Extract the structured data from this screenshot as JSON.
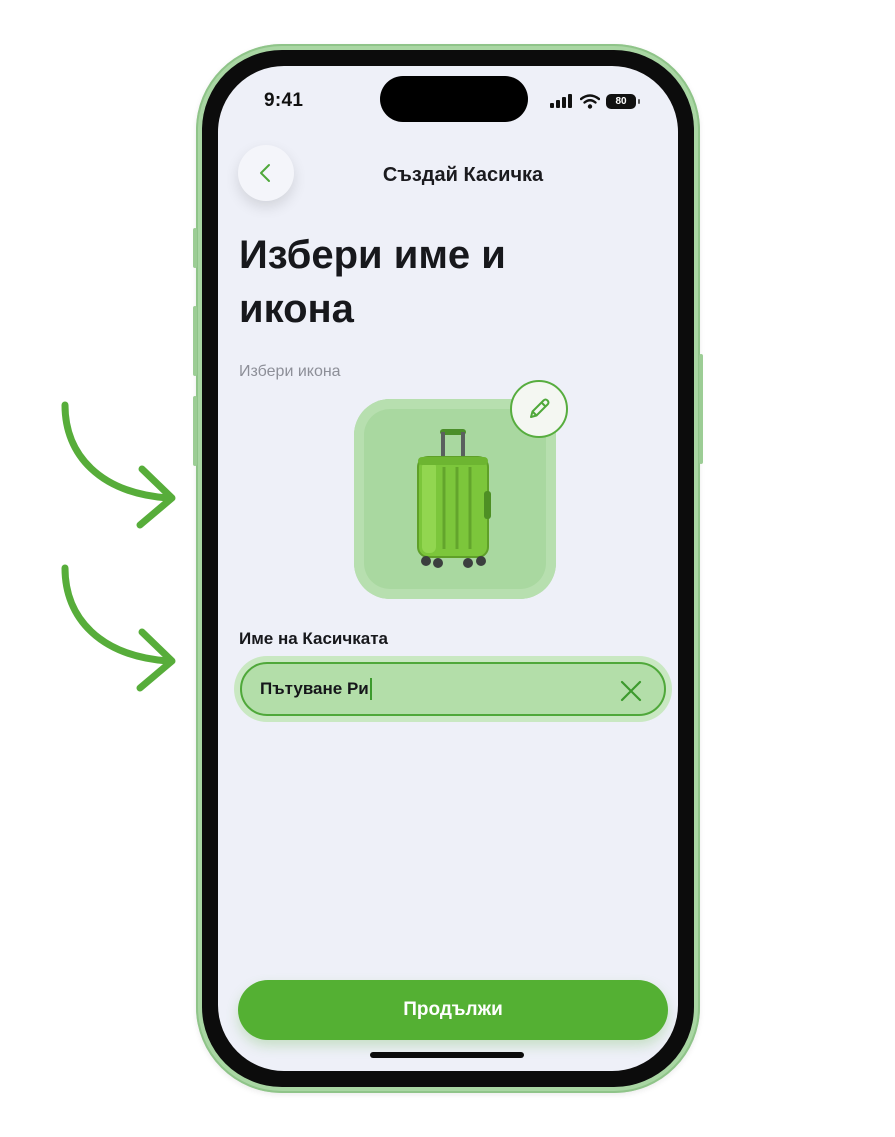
{
  "status_bar": {
    "time": "9:41",
    "battery": "80",
    "icons": [
      "signal-icon",
      "wifi-icon",
      "battery-icon"
    ]
  },
  "nav": {
    "back_icon": "chevron-left-icon",
    "title": "Създай Касичка"
  },
  "content": {
    "heading": "Избери име и икона",
    "subtitle": "Избери икона",
    "selected_icon": "suitcase-icon",
    "edit_icon": "pencil-icon",
    "field_label": "Име на Касичката",
    "field_value": "Пътуване Ри",
    "clear_icon": "close-icon"
  },
  "actions": {
    "continue_label": "Продължи"
  },
  "colors": {
    "accent": "#54b033",
    "tile": "#a9d8a0",
    "input_bg": "#b3dea9",
    "screen_bg": "#eef0f8"
  }
}
